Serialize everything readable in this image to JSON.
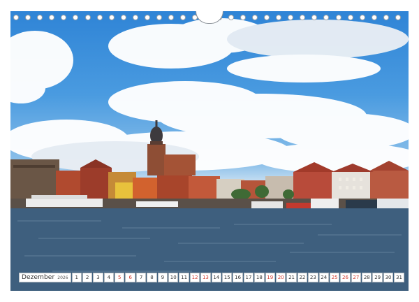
{
  "calendar": {
    "month": "Dezember",
    "year": "2026",
    "days": [
      {
        "n": "1",
        "we": false
      },
      {
        "n": "2",
        "we": false
      },
      {
        "n": "3",
        "we": false
      },
      {
        "n": "4",
        "we": false
      },
      {
        "n": "5",
        "we": true
      },
      {
        "n": "6",
        "we": true
      },
      {
        "n": "7",
        "we": false
      },
      {
        "n": "8",
        "we": false
      },
      {
        "n": "9",
        "we": false
      },
      {
        "n": "10",
        "we": false
      },
      {
        "n": "11",
        "we": false
      },
      {
        "n": "12",
        "we": true
      },
      {
        "n": "13",
        "we": true
      },
      {
        "n": "14",
        "we": false
      },
      {
        "n": "15",
        "we": false
      },
      {
        "n": "16",
        "we": false
      },
      {
        "n": "17",
        "we": false
      },
      {
        "n": "18",
        "we": false
      },
      {
        "n": "19",
        "we": true
      },
      {
        "n": "20",
        "we": true
      },
      {
        "n": "21",
        "we": false
      },
      {
        "n": "22",
        "we": false
      },
      {
        "n": "23",
        "we": false
      },
      {
        "n": "24",
        "we": false
      },
      {
        "n": "25",
        "we": true
      },
      {
        "n": "26",
        "we": true
      },
      {
        "n": "27",
        "we": true
      },
      {
        "n": "28",
        "we": false
      },
      {
        "n": "29",
        "we": false
      },
      {
        "n": "30",
        "we": false
      },
      {
        "n": "31",
        "we": false
      }
    ]
  },
  "colors": {
    "weekend": "#d23a2e",
    "sky": "#3f8fda",
    "water": "#3e5f7e"
  }
}
